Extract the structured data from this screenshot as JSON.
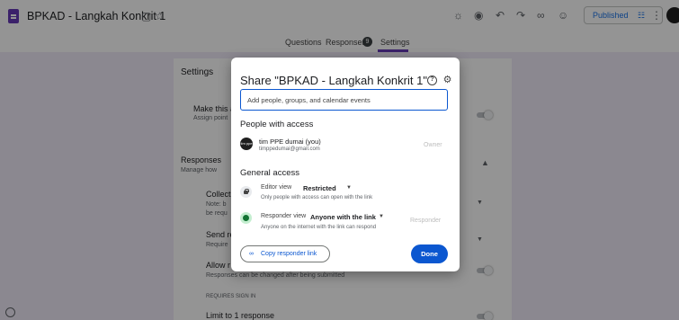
{
  "app": {
    "doc_title": "BPKAD - Langkah Konkrit 1",
    "title_icons": [
      "folder-icon",
      "star-icon"
    ],
    "toolbar_icons": [
      "palette-icon",
      "preview-icon",
      "undo-icon",
      "redo-icon",
      "link-icon",
      "add-collaborator-icon",
      "more-icon"
    ],
    "publish_label": "Published",
    "tabs": [
      {
        "label": "Questions"
      },
      {
        "label": "Responses",
        "badge": "9"
      },
      {
        "label": "Settings",
        "active": true
      }
    ]
  },
  "settings_page": {
    "heading": "Settings",
    "make_quiz": {
      "label": "Make this a",
      "sub": "Assign point"
    },
    "responses": {
      "label": "Responses",
      "sub": "Manage how"
    },
    "collect": {
      "label": "Collect",
      "sub1": "Note: b",
      "sub2": "be requ"
    },
    "send": {
      "label": "Send re",
      "sub": "Require"
    },
    "allow_edit": {
      "label": "Allow r",
      "sub": "Responses can be changed after being submitted"
    },
    "requires_sign_in": "REQUIRES SIGN IN",
    "limit": {
      "label": "Limit to 1 response"
    }
  },
  "dialog": {
    "title": "Share \"BPKAD - Langkah Konkrit 1\"",
    "add_placeholder": "Add people, groups, and calendar events",
    "people_heading": "People with access",
    "person": {
      "avatar_text": "tim ppe",
      "name": "tim PPE dumai (you)",
      "email": "timppedumai@gmail.com",
      "role": "Owner"
    },
    "general_heading": "General access",
    "editor": {
      "prefix": "Editor view",
      "value": "Restricted",
      "desc": "Only people with access can open with the link"
    },
    "responder": {
      "prefix": "Responder view",
      "value": "Anyone with the link",
      "desc": "Anyone on the internet with the link can respond",
      "role": "Responder"
    },
    "copy_label": "Copy responder link",
    "done_label": "Done"
  }
}
